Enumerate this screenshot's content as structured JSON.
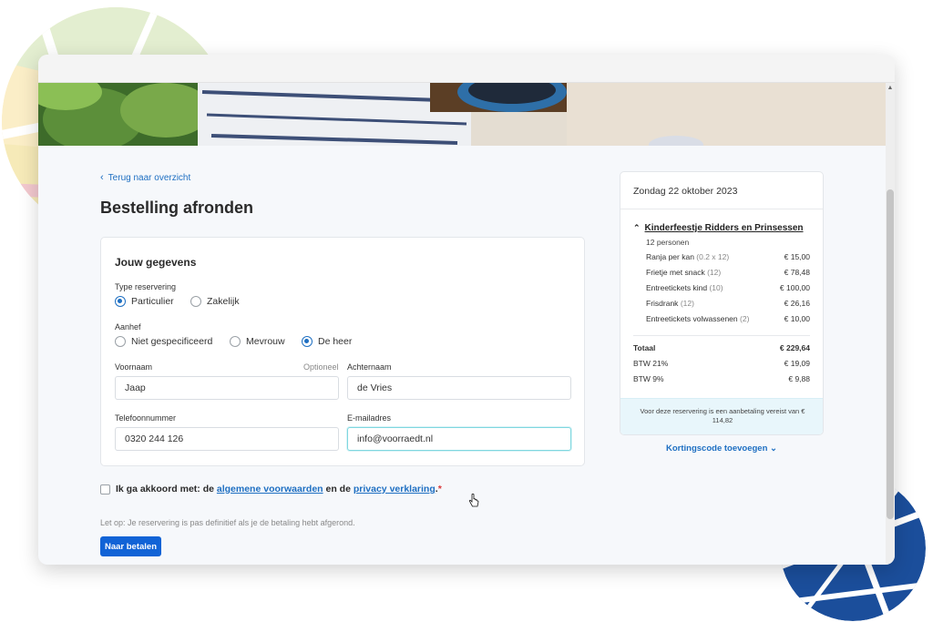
{
  "nav": {
    "back_label": "Terug naar overzicht"
  },
  "page": {
    "title": "Bestelling afronden"
  },
  "form": {
    "section_title": "Jouw gegevens",
    "reservation_type": {
      "label": "Type reservering",
      "options": [
        "Particulier",
        "Zakelijk"
      ],
      "selected": "Particulier"
    },
    "salutation": {
      "label": "Aanhef",
      "options": [
        "Niet gespecificeerd",
        "Mevrouw",
        "De heer"
      ],
      "selected": "De heer"
    },
    "first_name": {
      "label": "Voornaam",
      "optional_label": "Optioneel",
      "value": "Jaap"
    },
    "last_name": {
      "label": "Achternaam",
      "value": "de Vries"
    },
    "phone": {
      "label": "Telefoonnummer",
      "value": "0320 244 126"
    },
    "email": {
      "label": "E-mailadres",
      "value": "info@voorraedt.nl"
    }
  },
  "agreement": {
    "prefix": "Ik ga akkoord met: de",
    "terms_link": "algemene voorwaarden",
    "middle": "en de",
    "privacy_link": "privacy verklaring",
    "suffix": ".",
    "required_mark": "*"
  },
  "note": "Let op: Je reservering is pas definitief als je de betaling hebt afgerond.",
  "pay_button": "Naar betalen",
  "summary": {
    "date": "Zondag 22 oktober 2023",
    "event_title": "Kinderfeestje Ridders en Prinsessen",
    "persons": "12 personen",
    "items": [
      {
        "name": "Ranja per kan",
        "qty": "(0.2 x 12)",
        "price": "€ 15,00"
      },
      {
        "name": "Frietje met snack",
        "qty": "(12)",
        "price": "€ 78,48"
      },
      {
        "name": "Entreetickets kind",
        "qty": "(10)",
        "price": "€ 100,00"
      },
      {
        "name": "Frisdrank",
        "qty": "(12)",
        "price": "€ 26,16"
      },
      {
        "name": "Entreetickets volwassenen",
        "qty": "(2)",
        "price": "€ 10,00"
      }
    ],
    "total_label": "Totaal",
    "total_value": "€ 229,64",
    "vat21_label": "BTW 21%",
    "vat21_value": "€ 19,09",
    "vat9_label": "BTW 9%",
    "vat9_value": "€ 9,88",
    "deposit_text": "Voor deze reservering is een aanbetaling vereist van € 114,82"
  },
  "discount_link": "Kortingscode toevoegen",
  "colors": {
    "accent": "#1163d6",
    "link": "#1e6fc2",
    "active_field": "#7fd7df",
    "deposit_bg": "#e8f6fb"
  },
  "icons": [
    "chevron-left-icon",
    "chevron-up-icon",
    "chevron-down-icon",
    "hand-cursor-icon"
  ]
}
